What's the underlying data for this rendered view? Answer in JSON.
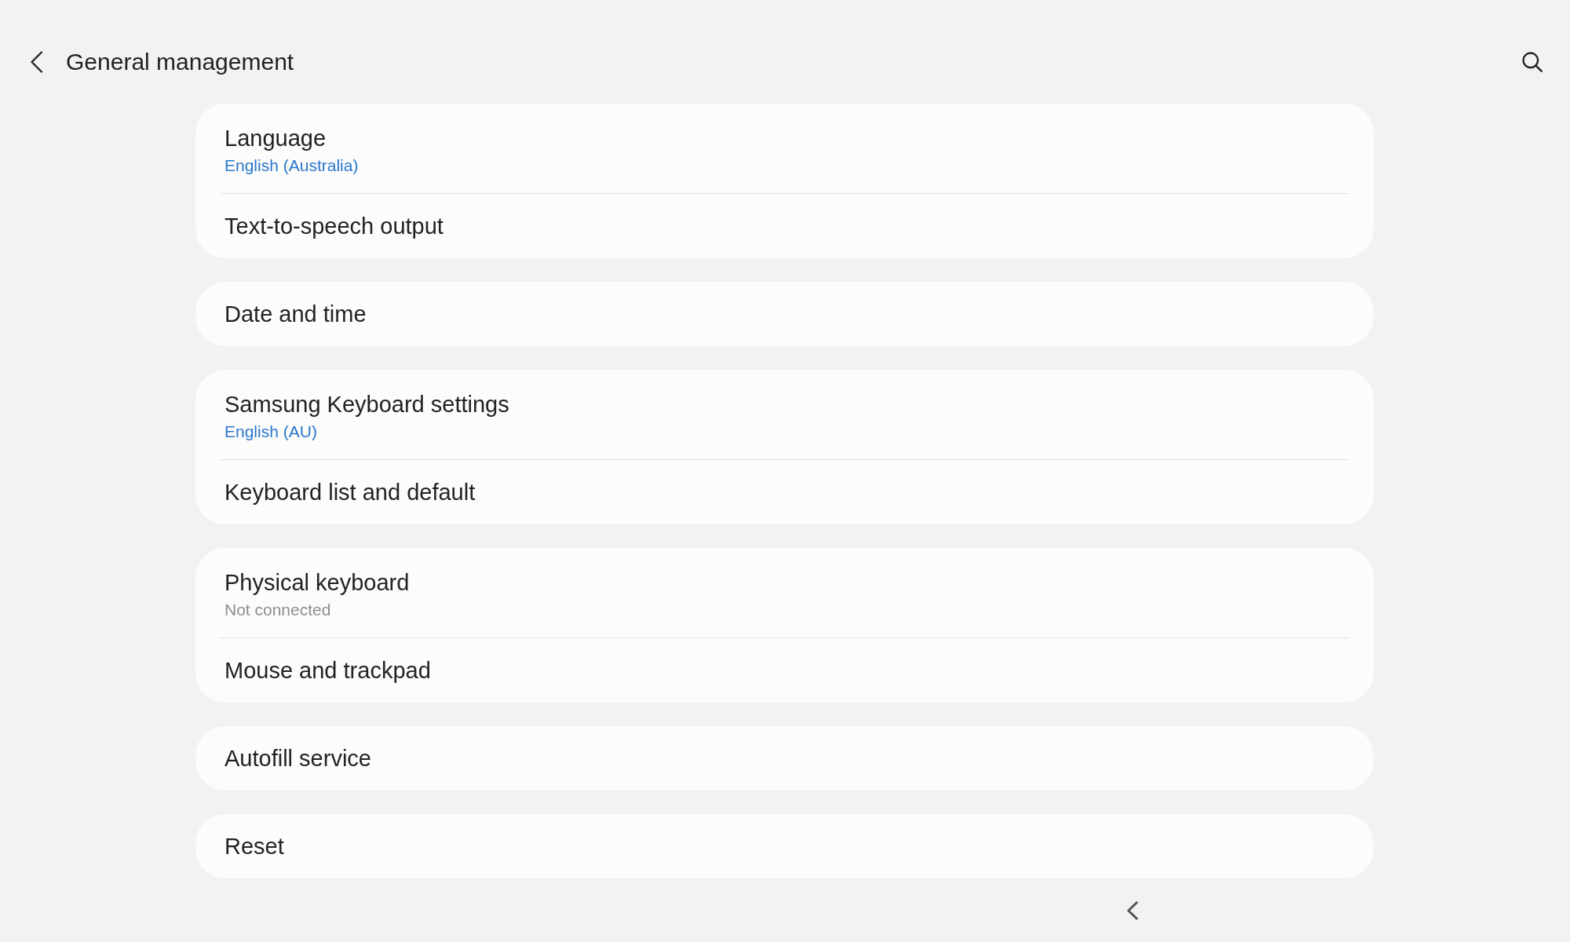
{
  "header": {
    "title": "General management"
  },
  "groups": [
    {
      "items": [
        {
          "kind": "value",
          "title": "Language",
          "subtitle": "English (Australia)"
        },
        {
          "kind": "plain",
          "title": "Text-to-speech output"
        }
      ]
    },
    {
      "items": [
        {
          "kind": "plain",
          "title": "Date and time"
        }
      ]
    },
    {
      "items": [
        {
          "kind": "value",
          "title": "Samsung Keyboard settings",
          "subtitle": "English (AU)"
        },
        {
          "kind": "plain",
          "title": "Keyboard list and default"
        }
      ]
    },
    {
      "items": [
        {
          "kind": "status",
          "title": "Physical keyboard",
          "subtitle": "Not connected"
        },
        {
          "kind": "plain",
          "title": "Mouse and trackpad"
        }
      ]
    },
    {
      "items": [
        {
          "kind": "plain",
          "title": "Autofill service"
        }
      ]
    },
    {
      "items": [
        {
          "kind": "plain",
          "title": "Reset"
        }
      ]
    }
  ]
}
